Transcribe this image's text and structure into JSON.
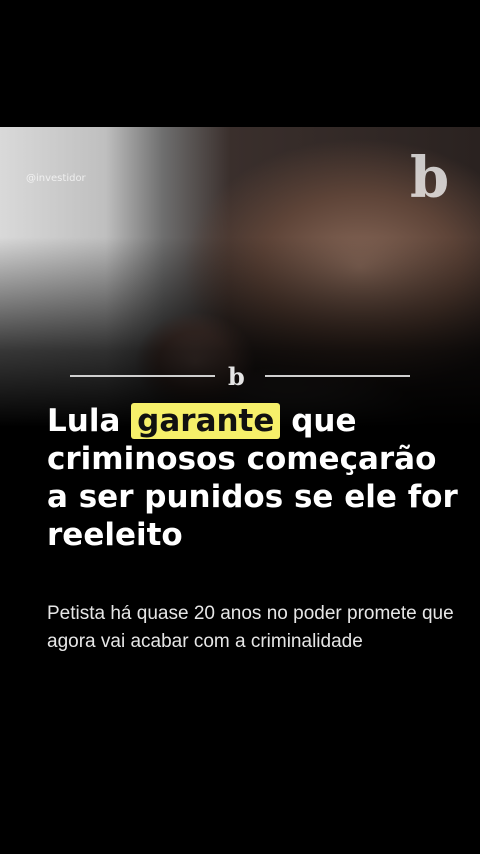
{
  "post": {
    "watermark": "@investidor",
    "brand_mark": "b",
    "headline": {
      "part1": "Lula",
      "highlight": "garante",
      "part2": "que criminosos começarão a ser punidos se ele for reeleito"
    },
    "subtitle": "Petista há quase 20 anos no poder promete que agora vai acabar com a criminalidade",
    "highlight_color": "#f6f06a"
  }
}
